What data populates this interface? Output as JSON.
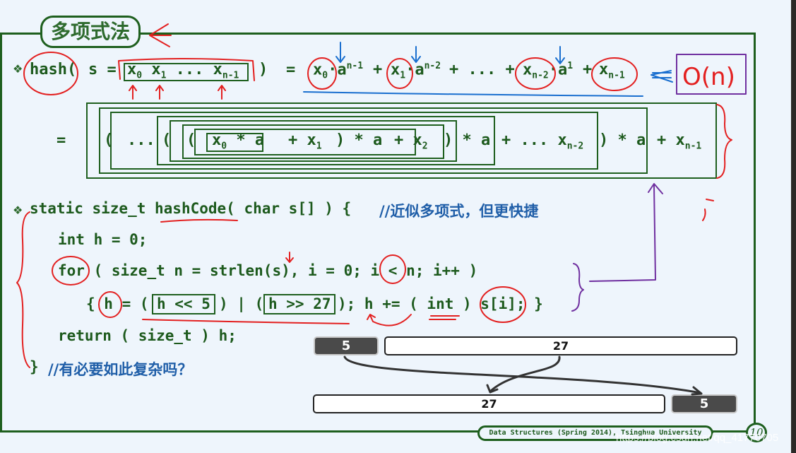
{
  "slide": {
    "title": "多项式法",
    "page_number": "10",
    "footer": "Data Structures (Spring 2014), Tsinghua University",
    "watermark": "https://blog.csdn.net/qq_41770705"
  },
  "colors": {
    "background": "#eef5fc",
    "frame_green": "#1e5f1e",
    "code_green": "#1d5a1d",
    "comment_blue": "#1f5ea8",
    "annotation_red": "#e32020",
    "annotation_blue": "#1a6fcf",
    "annotation_purple": "#7030a0"
  },
  "formula1": {
    "bullet": "❖",
    "lhs": "hash(",
    "s_eq": "s =",
    "seq": [
      "x",
      "0",
      "x",
      "1",
      "...",
      "x",
      "n-1"
    ],
    "close": ")",
    "eq": "=",
    "terms": [
      {
        "x": "x",
        "xsub": "0",
        "a": "a",
        "exp": "n-1"
      },
      {
        "x": "x",
        "xsub": "1",
        "a": "a",
        "exp": "n-2"
      },
      {
        "x": "x",
        "xsub": "n-2",
        "a": "a",
        "exp": "1"
      },
      {
        "x": "x",
        "xsub": "n-1"
      }
    ],
    "plus": "+",
    "ellipsis": "...",
    "complexity_annotation": "O(n)"
  },
  "formula2": {
    "eq": "=",
    "open_paren": "(",
    "ellipsis": "...",
    "inner": "x",
    "inner_sub0": "0",
    "times_a": "* a",
    "plus": "+",
    "x1": "x",
    "x1_sub": "1",
    "close_paren": ")",
    "x2": "x",
    "x2_sub": "2",
    "dots": "+ ...",
    "xn2": "x",
    "xn2_sub": "n-2",
    "xn1": "x",
    "xn1_sub": "n-1"
  },
  "code": {
    "bullet": "❖",
    "line1": "static size_t ",
    "fn_name": "hashCode(",
    "line1_rest": " char s[] ) { ",
    "comment1": "//近似多项式，但更快捷",
    "line2": "int h = 0;",
    "line3_for": "for",
    "line3_rest": " ( size_t n = strlen(s), i = 0; i < n; i++ )",
    "line4_open": "{ h = (",
    "shift_left": "h << 5",
    "line4_mid": ") | (",
    "shift_right": "h >> 27",
    "line4_rest": "); h += ( int ) s[i]; }",
    "line5": "return ( size_t ) h;",
    "line6_close": "}",
    "comment2": "//有必要如此复杂吗？"
  },
  "rotation_diagram": {
    "before": [
      {
        "label": "5",
        "style": "dark"
      },
      {
        "label": "27",
        "style": "light"
      }
    ],
    "after": [
      {
        "label": "27",
        "style": "light"
      },
      {
        "label": "5",
        "style": "dark"
      }
    ]
  }
}
